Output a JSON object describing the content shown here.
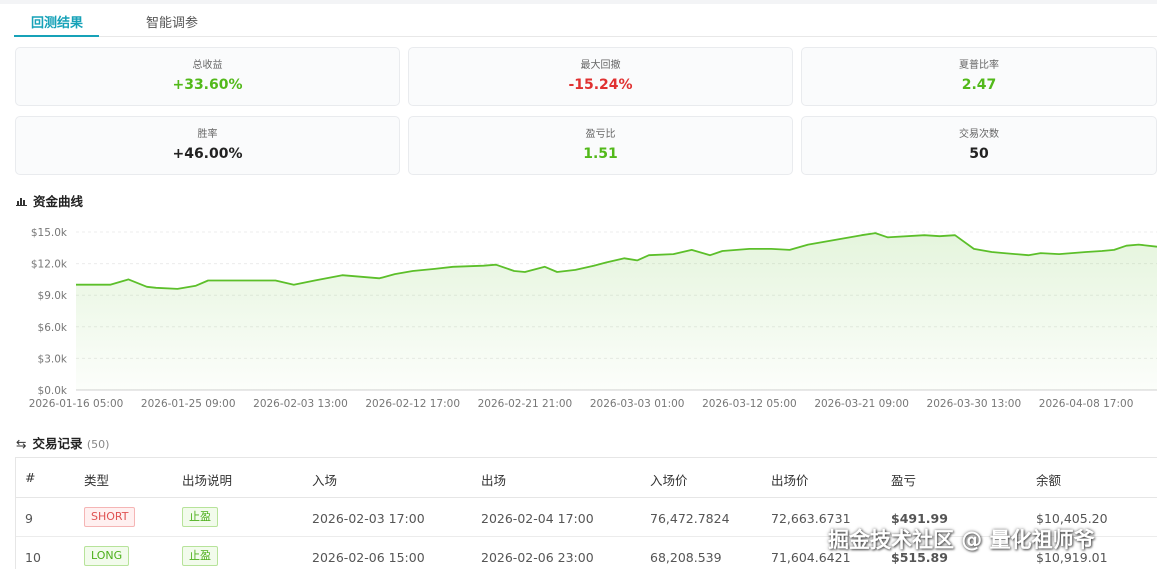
{
  "colors": {
    "accent": "#17a2b8",
    "positive": "#52b91a",
    "negative": "#e03131",
    "line": "#5cbf2a"
  },
  "tabs": [
    {
      "label": "回测结果",
      "active": true
    },
    {
      "label": "智能调参",
      "active": false
    }
  ],
  "stats": [
    {
      "label": "总收益",
      "value": "+33.60%",
      "tone": "positive"
    },
    {
      "label": "最大回撤",
      "value": "-15.24%",
      "tone": "negative"
    },
    {
      "label": "夏普比率",
      "value": "2.47",
      "tone": "positive"
    },
    {
      "label": "胜率",
      "value": "+46.00%",
      "tone": "neutral"
    },
    {
      "label": "盈亏比",
      "value": "1.51",
      "tone": "positive"
    },
    {
      "label": "交易次数",
      "value": "50",
      "tone": "neutral"
    }
  ],
  "equity_section": {
    "icon": "chart-icon",
    "title": "资金曲线"
  },
  "chart_data": {
    "type": "area",
    "title": "",
    "xlabel": "",
    "ylabel": "",
    "ylim": [
      0,
      15000
    ],
    "y_ticks": [
      "$0.0k",
      "$3.0k",
      "$6.0k",
      "$9.0k",
      "$12.0k",
      "$15.0k"
    ],
    "x_ticks": [
      "2026-01-16 05:00",
      "2026-01-25 09:00",
      "2026-02-03 13:00",
      "2026-02-12 17:00",
      "2026-02-21 21:00",
      "2026-03-03 01:00",
      "2026-03-12 05:00",
      "2026-03-21 09:00",
      "2026-03-30 13:00",
      "2026-04-08 17:00"
    ],
    "x_range": [
      "2026-01-16 05:00",
      "2026-04-14 12:00"
    ],
    "grid": true,
    "legend": "none",
    "series": [
      {
        "x": [
          "2026-01-16 05:00",
          "2026-01-19 00:00",
          "2026-01-20 12:00",
          "2026-01-22 00:00",
          "2026-01-22 18:00",
          "2026-01-24 12:00",
          "2026-01-26 00:00",
          "2026-01-27 00:00",
          "2026-01-29 00:00",
          "2026-02-01 12:00",
          "2026-02-03 00:00",
          "2026-02-04 17:00",
          "2026-02-06 23:00",
          "2026-02-10 00:00",
          "2026-02-11 06:00",
          "2026-02-12 17:00",
          "2026-02-14 12:00",
          "2026-02-16 00:00",
          "2026-02-18 12:00",
          "2026-02-19 12:00",
          "2026-02-21 00:00",
          "2026-02-21 21:00",
          "2026-02-23 12:00",
          "2026-02-24 12:00",
          "2026-02-26 00:00",
          "2026-02-27 12:00",
          "2026-02-28 12:00",
          "2026-03-02 00:00",
          "2026-03-03 01:00",
          "2026-03-04 00:00",
          "2026-03-06 00:00",
          "2026-03-07 12:00",
          "2026-03-09 00:00",
          "2026-03-10 00:00",
          "2026-03-12 05:00",
          "2026-03-14 00:00",
          "2026-03-15 12:00",
          "2026-03-17 00:00",
          "2026-03-21 09:00",
          "2026-03-22 12:00",
          "2026-03-23 12:00",
          "2026-03-26 12:00",
          "2026-03-27 18:00",
          "2026-03-29 00:00",
          "2026-03-30 13:00",
          "2026-04-01 00:00",
          "2026-04-02 00:00",
          "2026-04-04 00:00",
          "2026-04-05 00:00",
          "2026-04-06 12:00",
          "2026-04-08 17:00",
          "2026-04-10 00:00",
          "2026-04-11 00:00",
          "2026-04-12 00:00",
          "2026-04-13 00:00",
          "2026-04-14 12:00"
        ],
        "y": [
          10000,
          10000,
          10500,
          9800,
          9700,
          9600,
          9900,
          10400,
          10400,
          10400,
          10000,
          10400,
          10900,
          10600,
          11000,
          11300,
          11500,
          11700,
          11800,
          11900,
          11300,
          11200,
          11700,
          11200,
          11400,
          11800,
          12100,
          12500,
          12300,
          12800,
          12900,
          13300,
          12800,
          13200,
          13400,
          13400,
          13300,
          13800,
          14700,
          14900,
          14500,
          14700,
          14600,
          14700,
          13400,
          13100,
          13000,
          12800,
          13000,
          12900,
          13100,
          13200,
          13300,
          13700,
          13800,
          13600
        ]
      }
    ]
  },
  "trades_section": {
    "icon": "swap-icon",
    "title": "交易记录",
    "count": "(50)"
  },
  "table": {
    "columns": [
      "#",
      "类型",
      "出场说明",
      "入场",
      "出场",
      "入场价",
      "出场价",
      "盈亏",
      "余额"
    ],
    "rows": [
      {
        "id": "9",
        "type": "SHORT",
        "exit_note": "止盈",
        "entry": "2026-02-03 17:00",
        "exit": "2026-02-04 17:00",
        "entry_price": "76,472.7824",
        "exit_price": "72,663.6731",
        "pnl": "$491.99",
        "balance": "$10,405.20"
      },
      {
        "id": "10",
        "type": "LONG",
        "exit_note": "止盈",
        "entry": "2026-02-06 15:00",
        "exit": "2026-02-06 23:00",
        "entry_price": "68,208.539",
        "exit_price": "71,604.6421",
        "pnl": "$515.89",
        "balance": "$10,919.01"
      }
    ]
  },
  "watermark": "掘金技术社区 @ 量化祖师爷"
}
